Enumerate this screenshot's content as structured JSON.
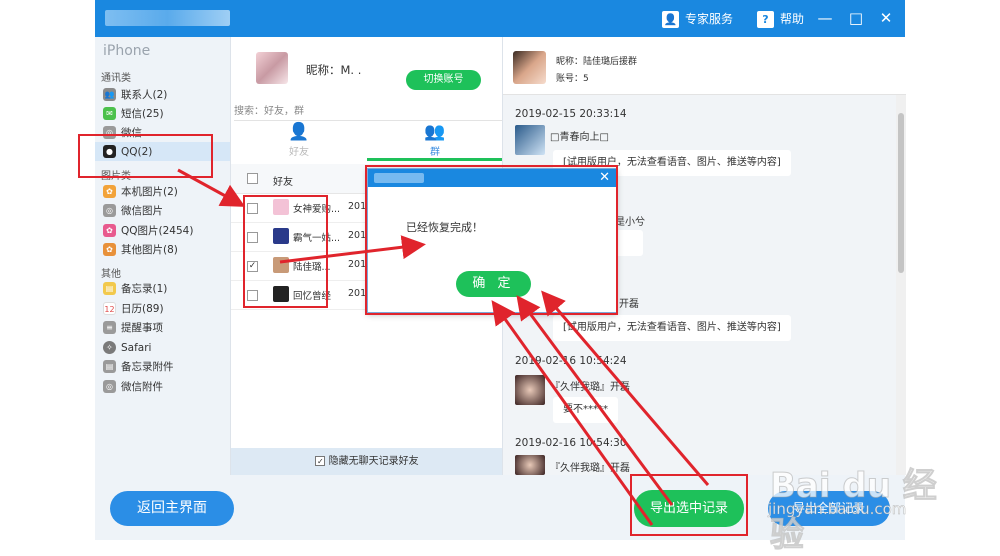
{
  "titlebar": {
    "expert_service": "专家服务",
    "help": "帮助",
    "minimize": "—",
    "maximize": "□",
    "close": "✕"
  },
  "sidebar": {
    "device": "iPhone",
    "categories": {
      "comm": "通讯类",
      "pics": "图片类",
      "other": "其他"
    },
    "items": [
      {
        "label": "联系人(2)",
        "icon": "contacts-icon",
        "color": "#8a8a8a"
      },
      {
        "label": "短信(25)",
        "icon": "sms-icon",
        "color": "#4cc14c"
      },
      {
        "label": "微信",
        "icon": "wechat-icon",
        "color": "#9a9a9a"
      },
      {
        "label": "QQ(2)",
        "icon": "qq-icon",
        "color": "#222222"
      },
      {
        "label": "本机图片(2)",
        "icon": "photos-icon",
        "color": "#f2a33a"
      },
      {
        "label": "微信图片",
        "icon": "wechat-photo-icon",
        "color": "#9a9a9a"
      },
      {
        "label": "QQ图片(2454)",
        "icon": "qq-photo-icon",
        "color": "#e85a8e"
      },
      {
        "label": "其他图片(8)",
        "icon": "other-photo-icon",
        "color": "#e8913a"
      },
      {
        "label": "备忘录(1)",
        "icon": "notes-icon",
        "color": "#f2c94c"
      },
      {
        "label": "日历(89)",
        "icon": "calendar-icon",
        "color": "#e04a4a"
      },
      {
        "label": "提醒事项",
        "icon": "reminders-icon",
        "color": "#9a9a9a"
      },
      {
        "label": "Safari",
        "icon": "safari-icon",
        "color": "#7a7a7a"
      },
      {
        "label": "备忘录附件",
        "icon": "notes-attach-icon",
        "color": "#9a9a9a"
      },
      {
        "label": "微信附件",
        "icon": "wechat-attach-icon",
        "color": "#9a9a9a"
      }
    ]
  },
  "middle": {
    "nickname_label": "昵称：M.  .",
    "switch_account": "切换账号",
    "search_placeholder": "搜索：好友，群",
    "tabs": [
      {
        "label": "好友",
        "icon": "person-icon"
      },
      {
        "label": "群",
        "icon": "group-icon"
      }
    ],
    "table_header": "好友",
    "rows": [
      {
        "name": "女神爱购...",
        "date": "2019",
        "checked": false,
        "color": "#f3c2d6"
      },
      {
        "name": "霸气一姑...",
        "date": "2019",
        "checked": false,
        "color": "#2a3a8a"
      },
      {
        "name": "陆佳璐...",
        "date": "2019",
        "checked": true,
        "color": "#c89a78"
      },
      {
        "name": "回忆曾经",
        "date": "2019",
        "checked": false,
        "color": "#222222"
      }
    ],
    "hide_empty": "隐藏无聊天记录好友"
  },
  "right": {
    "nickname": "昵称：陆佳璐后援群",
    "account": "账号：5",
    "messages": [
      {
        "time": "2019-02-15 20:33:14",
        "name": "□青春向上□",
        "text": "[试用版用户，无法查看语音、图片、推送等内容]"
      },
      {
        "name": "是小兮",
        "text": ""
      },
      {
        "name": "开磊",
        "text": "[试用版用户，无法查看语音、图片、推送等内容]"
      },
      {
        "time": "2019-02-16 10:54:24",
        "name": "『久伴我璐』开磊",
        "text": "要不*****"
      },
      {
        "time": "2019-02-16 10:54:30",
        "name": "『久伴我璐』开磊",
        "text": ""
      }
    ]
  },
  "dialog": {
    "message": "已经恢复完成！",
    "ok": "确 定",
    "close": "✕"
  },
  "footer": {
    "back": "返回主界面",
    "export_selected": "导出选中记录",
    "export_all": "导出全部记录"
  },
  "watermark": {
    "brand": "Bai du 经验",
    "site": "jingyan.baidu.com"
  },
  "colors": {
    "titlebar": "#1a88e0",
    "green": "#1ec15a",
    "blue_button": "#2b8ee6",
    "highlight": "#e0242c"
  }
}
